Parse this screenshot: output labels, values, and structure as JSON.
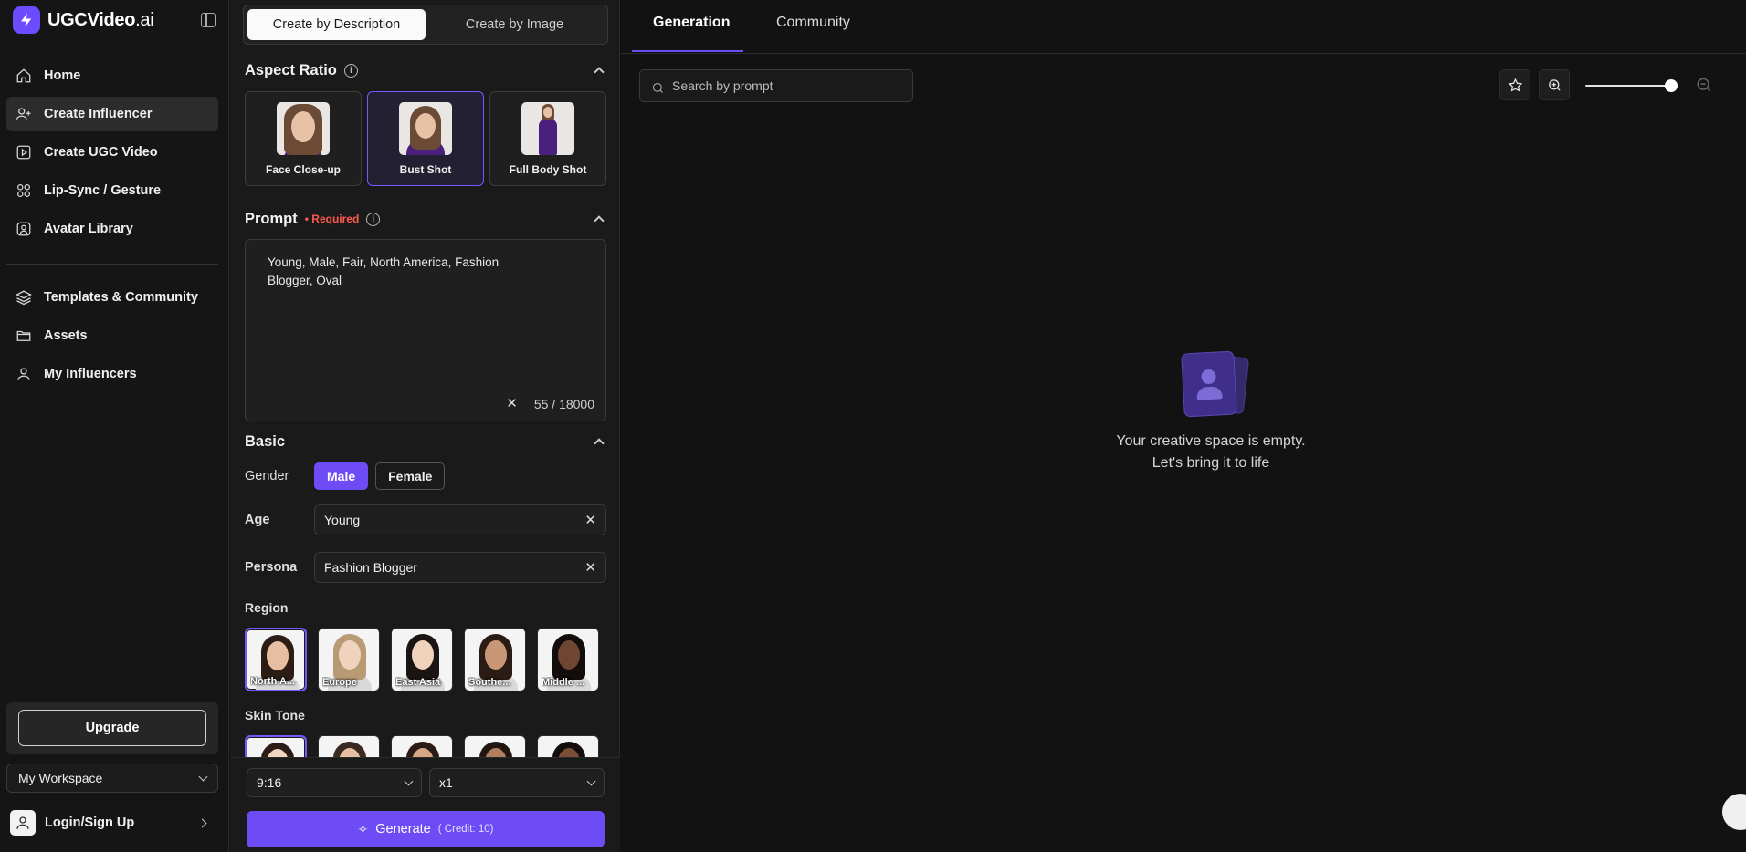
{
  "brand": {
    "name": "UGCVideo",
    "suffix": ".ai"
  },
  "sidebar": {
    "nav_primary": [
      {
        "label": "Home",
        "icon": "home-icon"
      },
      {
        "label": "Create Influencer",
        "icon": "user-plus-icon",
        "active": true
      },
      {
        "label": "Create UGC Video",
        "icon": "video-play-icon"
      },
      {
        "label": "Lip-Sync / Gesture",
        "icon": "grid-icon"
      },
      {
        "label": "Avatar Library",
        "icon": "avatar-icon"
      }
    ],
    "nav_secondary": [
      {
        "label": "Templates & Community",
        "icon": "layers-icon"
      },
      {
        "label": "Assets",
        "icon": "folder-icon"
      },
      {
        "label": "My Influencers",
        "icon": "user-icon"
      }
    ],
    "upgrade_label": "Upgrade",
    "workspace_label": "My Workspace",
    "login_label": "Login/Sign Up"
  },
  "panel": {
    "mode_tabs": [
      {
        "label": "Create by Description",
        "active": true
      },
      {
        "label": "Create by Image",
        "active": false
      }
    ],
    "aspect": {
      "title": "Aspect Ratio",
      "options": [
        {
          "label": "Face Close-up",
          "active": false
        },
        {
          "label": "Bust Shot",
          "active": true
        },
        {
          "label": "Full Body Shot",
          "active": false
        }
      ]
    },
    "prompt": {
      "title": "Prompt",
      "required": "• Required",
      "value": "Young, Male, Fair, North America, Fashion Blogger, Oval",
      "counter": "55 / 18000"
    },
    "basic": {
      "title": "Basic",
      "gender_label": "Gender",
      "gender_options": [
        "Male",
        "Female"
      ],
      "gender_selected": "Male",
      "age_label": "Age",
      "age_value": "Young",
      "persona_label": "Persona",
      "persona_value": "Fashion Blogger"
    },
    "region": {
      "title": "Region",
      "options": [
        {
          "label": "North A...",
          "active": true
        },
        {
          "label": "Europe",
          "active": false
        },
        {
          "label": "East Asia",
          "active": false
        },
        {
          "label": "Southe...",
          "active": false
        },
        {
          "label": "Middle ...",
          "active": false
        }
      ]
    },
    "skin_tone": {
      "title": "Skin Tone"
    },
    "footer": {
      "ratio_value": "9:16",
      "count_value": "x1",
      "generate_label": "Generate",
      "credit_label": "( Credit: 10)"
    }
  },
  "main": {
    "tabs": [
      {
        "label": "Generation",
        "active": true
      },
      {
        "label": "Community",
        "active": false
      }
    ],
    "search_placeholder": "Search by prompt",
    "zoom_level": 1.0,
    "empty_line1": "Your creative space is empty.",
    "empty_line2": "Let's bring it to life"
  },
  "colors": {
    "accent": "#6e4cf5",
    "background": "#121212",
    "required": "#ff5a4d"
  }
}
